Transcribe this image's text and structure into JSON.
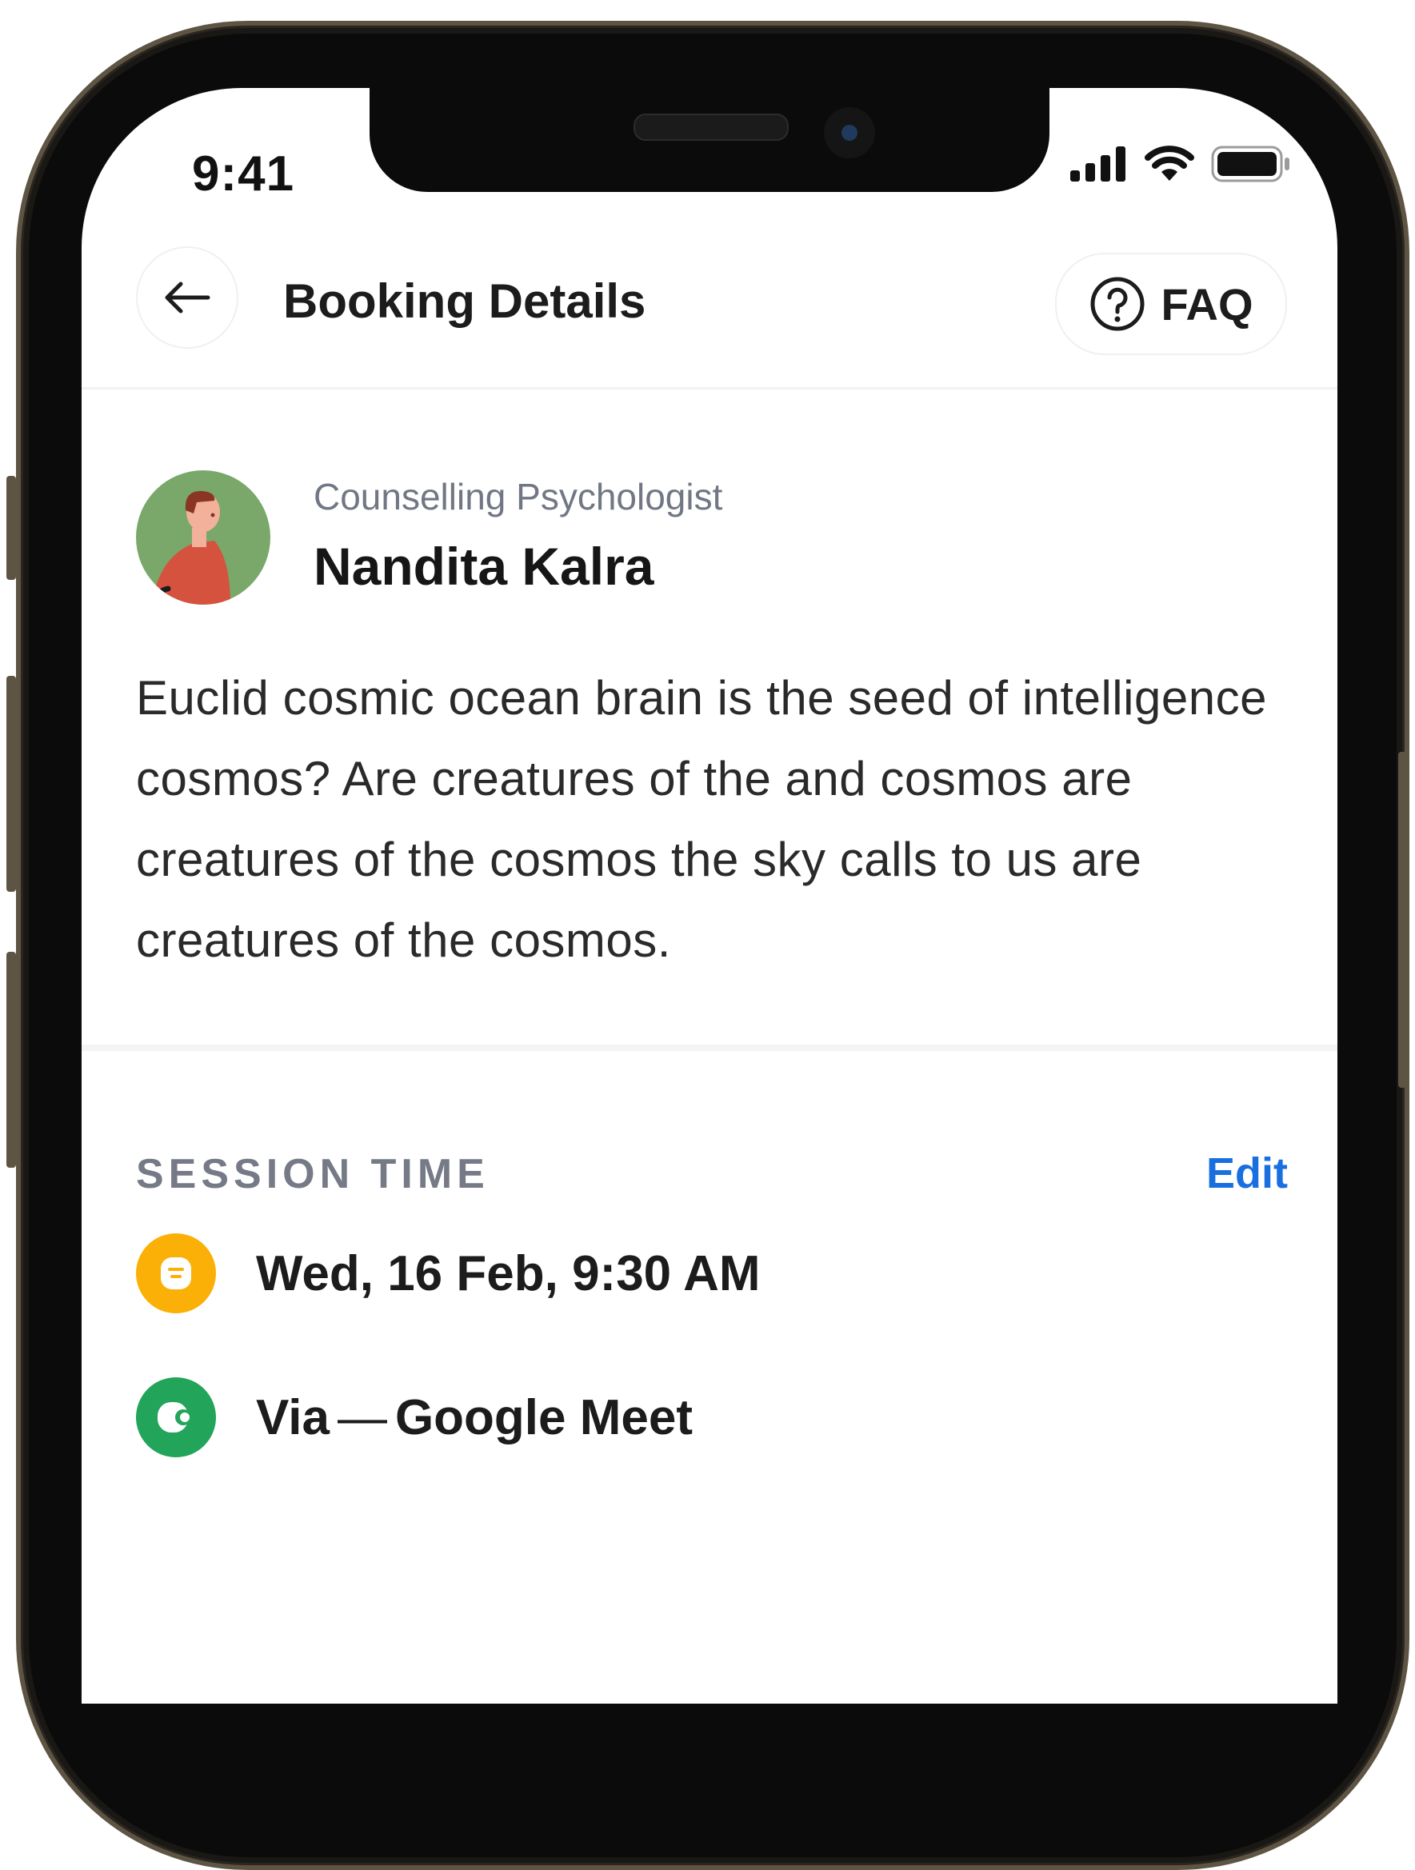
{
  "status_bar": {
    "time": "9:41"
  },
  "header": {
    "title": "Booking Details",
    "faq_label": "FAQ"
  },
  "profile": {
    "role": "Counselling Psychologist",
    "name": "Nandita Kalra",
    "description": "Euclid cosmic ocean brain is the seed of intelligence cosmos? Are creatures of the and cosmos are creatures of the cosmos the sky calls to us are creatures of the cosmos."
  },
  "session": {
    "section_title": "SESSION TIME",
    "edit_label": "Edit",
    "datetime": "Wed, 16 Feb, 9:30 AM",
    "via_prefix": "Via",
    "via_dash": "—",
    "via_platform": "Google Meet"
  },
  "colors": {
    "accent_blue": "#1a6fe0",
    "time_icon_bg": "#fbb008",
    "meet_icon_bg": "#22a45a",
    "avatar_bg": "#79a86a"
  }
}
